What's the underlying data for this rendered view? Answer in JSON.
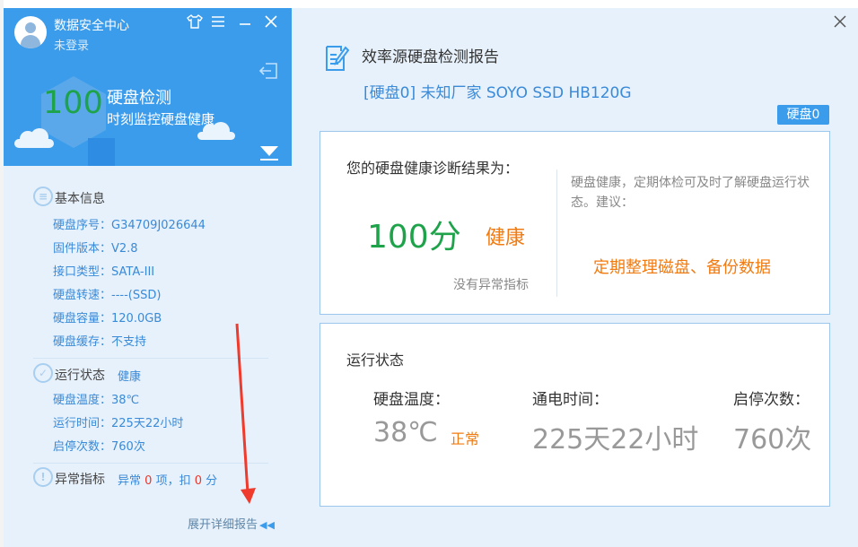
{
  "left": {
    "app_title": "数据安全中心",
    "login_status": "未登录",
    "score": "100",
    "check_title": "硬盘检测",
    "check_subtitle": "时刻监控硬盘健康",
    "basic_section": "基本信息",
    "info_rows": [
      {
        "label": "硬盘序号：",
        "value": "G34709J026644"
      },
      {
        "label": "固件版本：",
        "value": "V2.8"
      },
      {
        "label": "接口类型：",
        "value": "SATA-III"
      },
      {
        "label": "硬盘转速：",
        "value": "----(SSD)"
      },
      {
        "label": "硬盘容量：",
        "value": "120.0GB"
      },
      {
        "label": "硬盘缓存：",
        "value": "不支持"
      }
    ],
    "run_section": "运行状态",
    "run_status": "健康",
    "run_rows": [
      {
        "label": "硬盘温度：",
        "value": "38℃"
      },
      {
        "label": "运行时间：",
        "value": "225天22小时"
      },
      {
        "label": "启停次数：",
        "value": "760次"
      }
    ],
    "abnormal_section": "异常指标",
    "abnormal": {
      "prefix": "异常",
      "count": "0",
      "mid": "项，扣",
      "deduct": "0",
      "suffix": "分"
    },
    "expand_report": "展开详细报告"
  },
  "right": {
    "report_title": "效率源硬盘检测报告",
    "disk_name": "[硬盘0] 未知厂家 SOYO SSD HB120G",
    "disk_tab": "硬盘0",
    "diagnosis_title": "您的硬盘健康诊断结果为：",
    "score_text": "100分",
    "health_text": "健康",
    "no_abnormal": "没有异常指标",
    "advice_text": "硬盘健康，定期体检可及时了解硬盘运行状态。建议：",
    "advice_action": "定期整理磁盘、备份数据",
    "run_title": "运行状态",
    "metrics": [
      {
        "label": "硬盘温度：",
        "value": "38℃",
        "state": "正常"
      },
      {
        "label": "通电时间：",
        "value": "225天22小时"
      },
      {
        "label": "启停次数：",
        "value": "760次"
      }
    ]
  },
  "colors": {
    "header_blue": "#3c9cec",
    "score_green": "#1ea34a",
    "accent_orange": "#f07b12",
    "link_blue": "#3a8ad8",
    "alert_red": "#e8382c"
  },
  "icons": [
    "user-avatar-icon",
    "shirt-skin-icon",
    "menu-icon",
    "minimize-icon",
    "close-icon",
    "exit-icon",
    "expand-down-icon",
    "info-list-icon",
    "check-circle-icon",
    "warning-circle-icon",
    "report-doc-icon"
  ]
}
